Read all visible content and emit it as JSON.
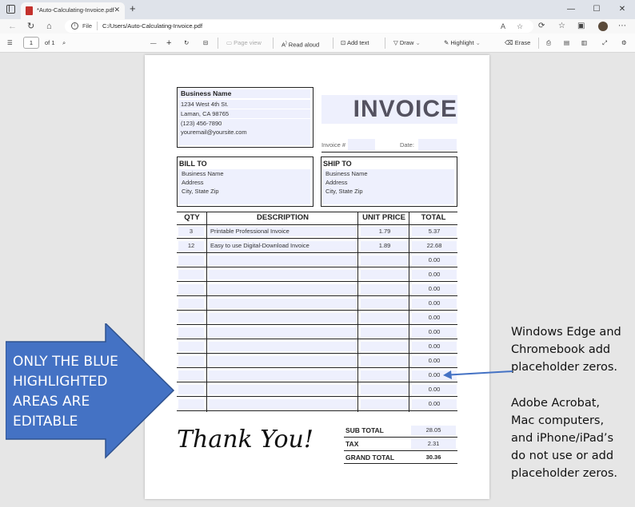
{
  "browser": {
    "tab_title": "*Auto-Calculating-Invoice.pdf",
    "tab_close": "✕",
    "new_tab": "+",
    "min": "—",
    "max": "☐",
    "close": "✕",
    "url_scheme_label": "File",
    "url": "C:/Users/Auto-Calculating-Invoice.pdf"
  },
  "pdf_toolbar": {
    "page_number": "1",
    "page_count": "of 1",
    "zoom_out": "—",
    "zoom_in": "+",
    "page_view": "Page view",
    "read_aloud": "Read aloud",
    "add_text": "Add text",
    "draw": "Draw",
    "highlight": "Highlight",
    "erase": "Erase"
  },
  "invoice": {
    "business": {
      "name": "Business Name",
      "street": "1234 West 4th St.",
      "city": "Laman, CA 98765",
      "phone": "(123) 456-7890",
      "email": "youremail@yoursite.com"
    },
    "title": "INVOICE",
    "invoice_number_label": "Invoice #",
    "date_label": "Date:",
    "bill_to": {
      "heading": "BILL TO",
      "name": "Business Name",
      "address": "Address",
      "city": "City, State Zip"
    },
    "ship_to": {
      "heading": "SHIP TO",
      "name": "Business Name",
      "address": "Address",
      "city": "City, State Zip"
    },
    "columns": {
      "qty": "QTY",
      "description": "DESCRIPTION",
      "unit_price": "UNIT PRICE",
      "total": "TOTAL"
    },
    "rows": [
      {
        "qty": "3",
        "description": "Printable Professional Invoice",
        "unit_price": "1.79",
        "total": "5.37"
      },
      {
        "qty": "12",
        "description": "Easy to use Digital-Download Invoice",
        "unit_price": "1.89",
        "total": "22.68"
      },
      {
        "qty": "",
        "description": "",
        "unit_price": "",
        "total": "0.00"
      },
      {
        "qty": "",
        "description": "",
        "unit_price": "",
        "total": "0.00"
      },
      {
        "qty": "",
        "description": "",
        "unit_price": "",
        "total": "0.00"
      },
      {
        "qty": "",
        "description": "",
        "unit_price": "",
        "total": "0.00"
      },
      {
        "qty": "",
        "description": "",
        "unit_price": "",
        "total": "0.00"
      },
      {
        "qty": "",
        "description": "",
        "unit_price": "",
        "total": "0.00"
      },
      {
        "qty": "",
        "description": "",
        "unit_price": "",
        "total": "0.00"
      },
      {
        "qty": "",
        "description": "",
        "unit_price": "",
        "total": "0.00"
      },
      {
        "qty": "",
        "description": "",
        "unit_price": "",
        "total": "0.00"
      },
      {
        "qty": "",
        "description": "",
        "unit_price": "",
        "total": "0.00"
      },
      {
        "qty": "",
        "description": "",
        "unit_price": "",
        "total": "0.00"
      }
    ],
    "thank_you": "Thank You!",
    "sub_total_label": "SUB TOTAL",
    "sub_total": "28.05",
    "tax_label": "TAX",
    "tax": "2.31",
    "grand_total_label": "GRAND TOTAL",
    "grand_total": "30.36"
  },
  "annotations": {
    "left_arrow_lines": [
      "ONLY THE BLUE",
      "HIGHLIGHTED",
      "AREAS ARE",
      "EDITABLE"
    ],
    "right_top_lines": [
      "Windows Edge and",
      "Chromebook add",
      "placeholder zeros."
    ],
    "right_bottom_lines": [
      "Adobe Acrobat,",
      "Mac computers,",
      "and iPhone/iPad’s",
      "do not use or add",
      "placeholder zeros."
    ],
    "arrow_color": "#4472c4",
    "highlight_color": "#eef0fd"
  }
}
